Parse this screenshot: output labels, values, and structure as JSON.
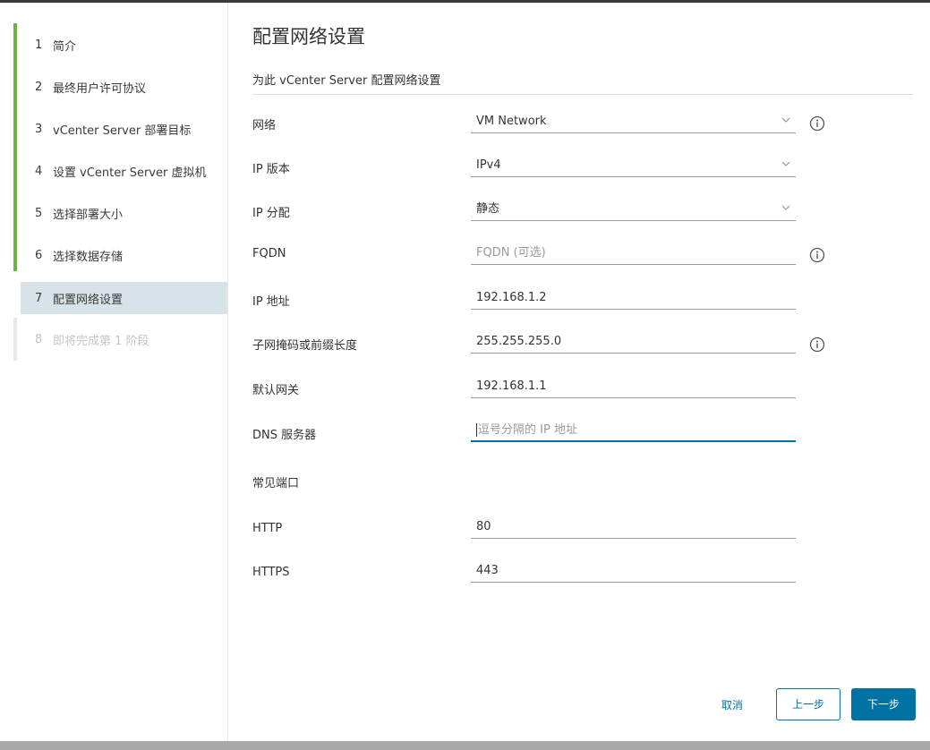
{
  "steps": [
    {
      "num": "1",
      "label": "简介"
    },
    {
      "num": "2",
      "label": "最终用户许可协议"
    },
    {
      "num": "3",
      "label": "vCenter Server 部署目标"
    },
    {
      "num": "4",
      "label": "设置 vCenter Server 虚拟机"
    },
    {
      "num": "5",
      "label": "选择部署大小"
    },
    {
      "num": "6",
      "label": "选择数据存储"
    },
    {
      "num": "7",
      "label": "配置网络设置"
    },
    {
      "num": "8",
      "label": "即将完成第 1 阶段"
    }
  ],
  "page": {
    "title": "配置网络设置",
    "subtitle": "为此 vCenter Server 配置网络设置"
  },
  "form": {
    "network": {
      "label": "网络",
      "value": "VM Network"
    },
    "ip_version": {
      "label": "IP 版本",
      "value": "IPv4"
    },
    "ip_assignment": {
      "label": "IP 分配",
      "value": "静态"
    },
    "fqdn": {
      "label": "FQDN",
      "placeholder": "FQDN (可选)"
    },
    "ip_address": {
      "label": "IP 地址",
      "value": "192.168.1.2"
    },
    "subnet": {
      "label": "子网掩码或前缀长度",
      "value": "255.255.255.0"
    },
    "gateway": {
      "label": "默认网关",
      "value": "192.168.1.1"
    },
    "dns": {
      "label": "DNS 服务器",
      "placeholder": "逗号分隔的 IP 地址"
    },
    "common_ports": {
      "label": "常见端口"
    },
    "http": {
      "label": "HTTP",
      "value": "80"
    },
    "https": {
      "label": "HTTPS",
      "value": "443"
    }
  },
  "footer": {
    "cancel": "取消",
    "back": "上一步",
    "next": "下一步"
  },
  "colors": {
    "accent": "#0072a3",
    "step_complete": "#6db33f",
    "step_active_bg": "#d8e3e9"
  }
}
